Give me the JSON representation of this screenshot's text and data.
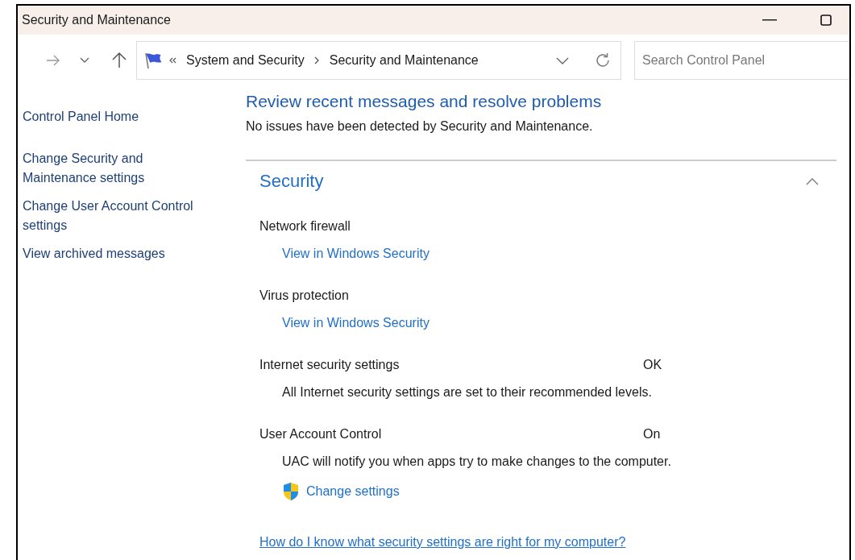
{
  "window": {
    "title": "Security and Maintenance"
  },
  "address_bar": {
    "breadcrumbs": [
      "System and Security",
      "Security and Maintenance"
    ]
  },
  "search": {
    "placeholder": "Search Control Panel"
  },
  "sidebar": {
    "items": [
      "Control Panel Home",
      "Change Security and Maintenance settings",
      "Change User Account Control settings",
      "View archived messages"
    ]
  },
  "main": {
    "heading": "Review recent messages and resolve problems",
    "summary": "No issues have been detected by Security and Maintenance.",
    "section": {
      "title": "Security",
      "expanded": true,
      "items": [
        {
          "name": "Network firewall",
          "link": {
            "label": "View in Windows Security",
            "shield": false
          }
        },
        {
          "name": "Virus protection",
          "link": {
            "label": "View in Windows Security",
            "shield": false
          }
        },
        {
          "name": "Internet security settings",
          "status": "OK",
          "description": "All Internet security settings are set to their recommended levels."
        },
        {
          "name": "User Account Control",
          "status": "On",
          "description": "UAC will notify you when apps try to make changes to the computer.",
          "link": {
            "label": "Change settings",
            "shield": true
          }
        }
      ]
    },
    "help_link": "How do I know what security settings are right for my computer?"
  }
}
